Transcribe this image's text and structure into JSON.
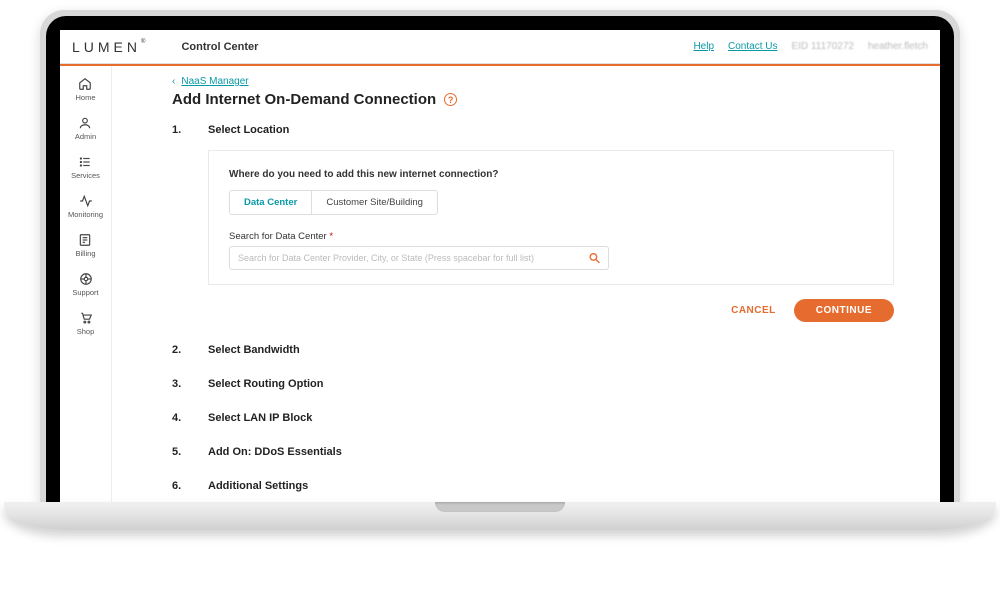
{
  "header": {
    "brand": "LUMEN",
    "brand_mark": "®",
    "app_title": "Control Center",
    "links": {
      "help": "Help",
      "contact": "Contact Us"
    },
    "eid": "EID 11170272",
    "user": "heather.fletch"
  },
  "sidebar": {
    "items": [
      {
        "label": "Home"
      },
      {
        "label": "Admin"
      },
      {
        "label": "Services"
      },
      {
        "label": "Monitoring"
      },
      {
        "label": "Billing"
      },
      {
        "label": "Support"
      },
      {
        "label": "Shop"
      }
    ]
  },
  "breadcrumb": {
    "parent": "NaaS Manager"
  },
  "page": {
    "title": "Add Internet On-Demand Connection",
    "help_glyph": "?"
  },
  "step1": {
    "num": "1.",
    "title": "Select Location",
    "prompt": "Where do you need to add this new internet connection?",
    "seg_option_a": "Data Center",
    "seg_option_b": "Customer Site/Building",
    "search_label": "Search for Data Center",
    "search_required": "*",
    "search_placeholder": "Search for Data Center Provider, City, or State (Press spacebar for full list)"
  },
  "actions": {
    "cancel": "CANCEL",
    "continue": "CONTINUE"
  },
  "steps_rest": [
    {
      "num": "2.",
      "title": "Select Bandwidth"
    },
    {
      "num": "3.",
      "title": "Select Routing Option"
    },
    {
      "num": "4.",
      "title": "Select LAN IP Block"
    },
    {
      "num": "5.",
      "title": "Add On: DDoS Essentials"
    },
    {
      "num": "6.",
      "title": "Additional Settings"
    }
  ]
}
